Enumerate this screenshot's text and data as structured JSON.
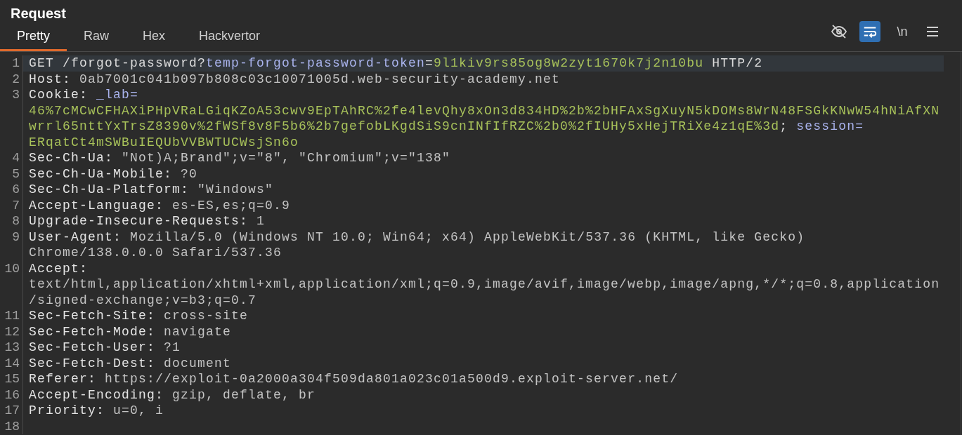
{
  "title": "Request",
  "tabs": [
    {
      "label": "Pretty",
      "selected": true
    },
    {
      "label": "Raw",
      "selected": false
    },
    {
      "label": "Hex",
      "selected": false
    },
    {
      "label": "Hackvertor",
      "selected": false
    }
  ],
  "toolbar": {
    "hide_toggle": {
      "on": false
    },
    "wrap_toggle": {
      "on": true
    },
    "newline_toggle": {
      "label": "\\n",
      "on": false
    }
  },
  "lines": [
    {
      "number": "1",
      "selected": true,
      "rows": [
        {
          "tokens": [
            {
              "text": "GET /forgot-password?",
              "kind": "plain"
            },
            {
              "text": "temp-forgot-password-token",
              "kind": "param"
            },
            {
              "text": "=",
              "kind": "plain"
            },
            {
              "text": "9l1kiv9rs85og8w2zyt1670k7j2n10bu",
              "kind": "pvalue"
            },
            {
              "text": " HTTP/2",
              "kind": "plain"
            }
          ]
        }
      ]
    },
    {
      "number": "2",
      "selected": false,
      "rows": [
        {
          "tokens": [
            {
              "text": "Host:",
              "kind": "name"
            },
            {
              "text": " 0ab7001c041b097b808c03c10071005d.web-security-academy.net",
              "kind": "value"
            }
          ]
        }
      ]
    },
    {
      "number": "3",
      "selected": false,
      "rows": [
        {
          "tokens": [
            {
              "text": "Cookie:",
              "kind": "name"
            },
            {
              "text": " _lab=",
              "kind": "param"
            }
          ]
        },
        {
          "tokens": [
            {
              "text": "46%7cMCwCFHAXiPHpVRaLGiqKZoA53cwv9EpTAhRC%2fe4levQhy8xOn3d834HD%2b%2bHFAxSgXuyN5kDOMs8WrN48FSGkKNwW54hNiAfXN",
              "kind": "pvalue"
            }
          ]
        },
        {
          "tokens": [
            {
              "text": "wrrl65nttYxTrsZ8390v%2fWSf8v8F5b6%2b7gefobLKgdSiS9cnINfIfRZC%2b0%2fIUHy5xHejTRiXe4z1qE%3d",
              "kind": "pvalue"
            },
            {
              "text": "; ",
              "kind": "plain"
            },
            {
              "text": "session=",
              "kind": "param"
            }
          ]
        },
        {
          "tokens": [
            {
              "text": "ERqatCt4mSWBuIEQUbVVBWTUCWsjSn6o",
              "kind": "pvalue"
            }
          ]
        }
      ]
    },
    {
      "number": "4",
      "selected": false,
      "rows": [
        {
          "tokens": [
            {
              "text": "Sec-Ch-Ua:",
              "kind": "name"
            },
            {
              "text": " \"Not)A;Brand\";v=\"8\", \"Chromium\";v=\"138\"",
              "kind": "value"
            }
          ]
        }
      ]
    },
    {
      "number": "5",
      "selected": false,
      "rows": [
        {
          "tokens": [
            {
              "text": "Sec-Ch-Ua-Mobile:",
              "kind": "name"
            },
            {
              "text": " ?0",
              "kind": "value"
            }
          ]
        }
      ]
    },
    {
      "number": "6",
      "selected": false,
      "rows": [
        {
          "tokens": [
            {
              "text": "Sec-Ch-Ua-Platform:",
              "kind": "name"
            },
            {
              "text": " \"Windows\"",
              "kind": "value"
            }
          ]
        }
      ]
    },
    {
      "number": "7",
      "selected": false,
      "rows": [
        {
          "tokens": [
            {
              "text": "Accept-Language:",
              "kind": "name"
            },
            {
              "text": " es-ES,es;q=0.9",
              "kind": "value"
            }
          ]
        }
      ]
    },
    {
      "number": "8",
      "selected": false,
      "rows": [
        {
          "tokens": [
            {
              "text": "Upgrade-Insecure-Requests:",
              "kind": "name"
            },
            {
              "text": " 1",
              "kind": "value"
            }
          ]
        }
      ]
    },
    {
      "number": "9",
      "selected": false,
      "rows": [
        {
          "tokens": [
            {
              "text": "User-Agent:",
              "kind": "name"
            },
            {
              "text": " Mozilla/5.0 (Windows NT 10.0; Win64; x64) AppleWebKit/537.36 (KHTML, like Gecko)",
              "kind": "value"
            }
          ]
        },
        {
          "tokens": [
            {
              "text": "Chrome/138.0.0.0 Safari/537.36",
              "kind": "value"
            }
          ]
        }
      ]
    },
    {
      "number": "10",
      "selected": false,
      "rows": [
        {
          "tokens": [
            {
              "text": "Accept:",
              "kind": "name"
            }
          ]
        },
        {
          "tokens": [
            {
              "text": "text/html,application/xhtml+xml,application/xml;q=0.9,image/avif,image/webp,image/apng,*/*;q=0.8,application",
              "kind": "value"
            }
          ]
        },
        {
          "tokens": [
            {
              "text": "/signed-exchange;v=b3;q=0.7",
              "kind": "value"
            }
          ]
        }
      ]
    },
    {
      "number": "11",
      "selected": false,
      "rows": [
        {
          "tokens": [
            {
              "text": "Sec-Fetch-Site:",
              "kind": "name"
            },
            {
              "text": " cross-site",
              "kind": "value"
            }
          ]
        }
      ]
    },
    {
      "number": "12",
      "selected": false,
      "rows": [
        {
          "tokens": [
            {
              "text": "Sec-Fetch-Mode:",
              "kind": "name"
            },
            {
              "text": " navigate",
              "kind": "value"
            }
          ]
        }
      ]
    },
    {
      "number": "13",
      "selected": false,
      "rows": [
        {
          "tokens": [
            {
              "text": "Sec-Fetch-User:",
              "kind": "name"
            },
            {
              "text": " ?1",
              "kind": "value"
            }
          ]
        }
      ]
    },
    {
      "number": "14",
      "selected": false,
      "rows": [
        {
          "tokens": [
            {
              "text": "Sec-Fetch-Dest:",
              "kind": "name"
            },
            {
              "text": " document",
              "kind": "value"
            }
          ]
        }
      ]
    },
    {
      "number": "15",
      "selected": false,
      "rows": [
        {
          "tokens": [
            {
              "text": "Referer:",
              "kind": "name"
            },
            {
              "text": " https://exploit-0a2000a304f509da801a023c01a500d9.exploit-server.net/",
              "kind": "value"
            }
          ]
        }
      ]
    },
    {
      "number": "16",
      "selected": false,
      "rows": [
        {
          "tokens": [
            {
              "text": "Accept-Encoding:",
              "kind": "name"
            },
            {
              "text": " gzip, deflate, br",
              "kind": "value"
            }
          ]
        }
      ]
    },
    {
      "number": "17",
      "selected": false,
      "rows": [
        {
          "tokens": [
            {
              "text": "Priority:",
              "kind": "name"
            },
            {
              "text": " u=0, i",
              "kind": "value"
            }
          ]
        }
      ]
    },
    {
      "number": "18",
      "selected": false
    }
  ]
}
